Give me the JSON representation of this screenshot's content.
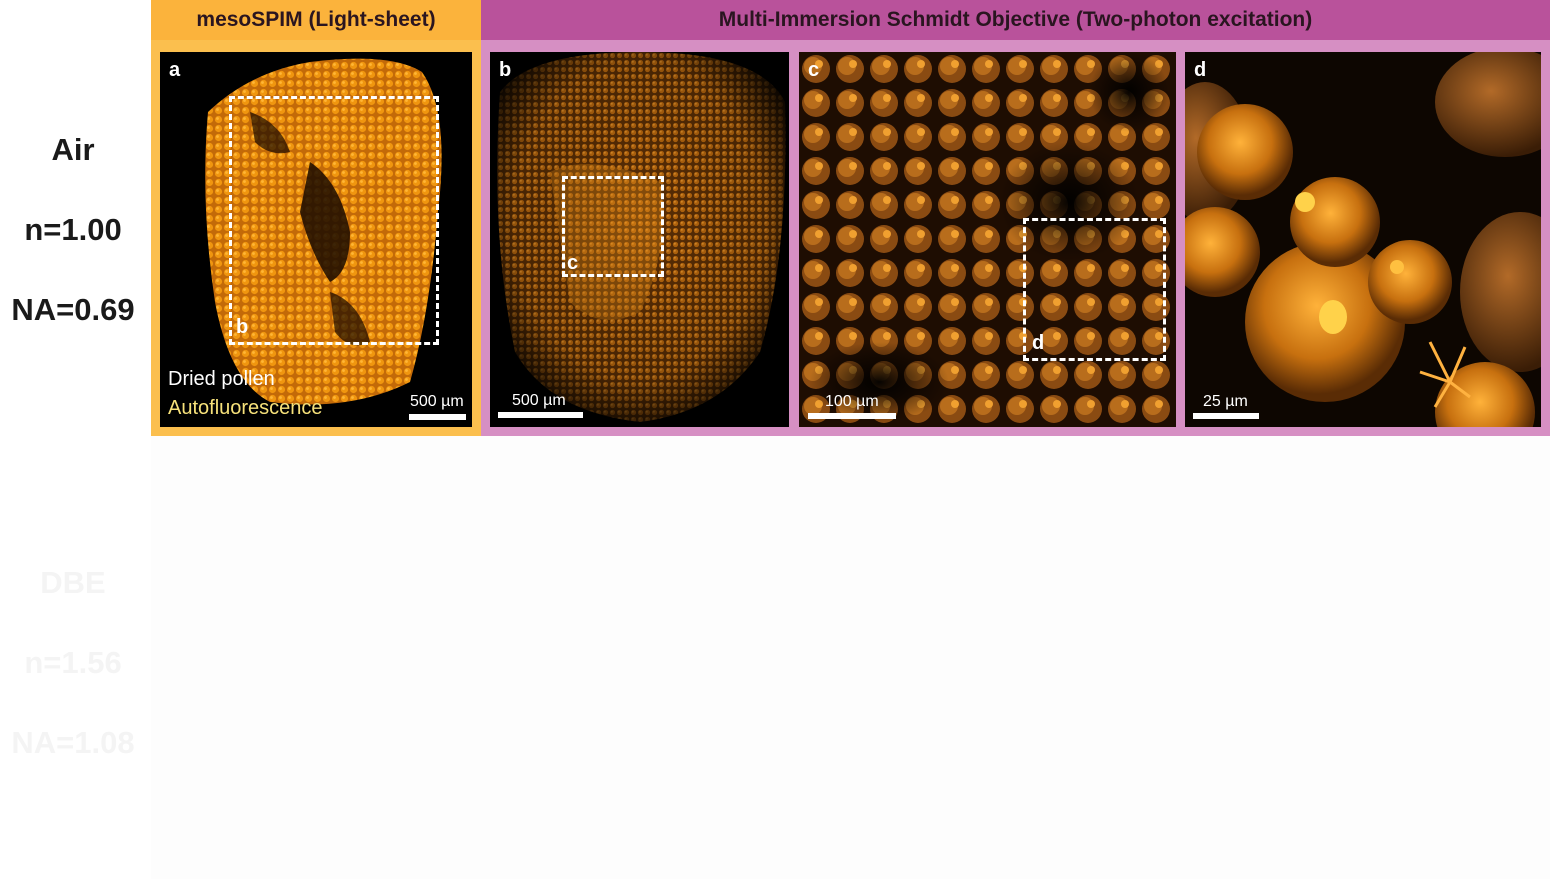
{
  "headers": {
    "left": "mesoSPIM (Light-sheet)",
    "right": "Multi-Immersion Schmidt Objective (Two-photon excitation)"
  },
  "rows": [
    {
      "medium": "Air",
      "n": "n=1.00",
      "na": "NA=0.69"
    },
    {
      "medium": "DBE",
      "n": "n=1.56",
      "na": "NA=1.08"
    }
  ],
  "panels": {
    "a": {
      "label": "a",
      "scale": "500 µm",
      "sample": "Dried pollen",
      "channel": "Autofluorescence",
      "roi": "b"
    },
    "b": {
      "label": "b",
      "scale": "500 µm",
      "roi": "c"
    },
    "c": {
      "label": "c",
      "scale": "100 µm",
      "roi": "d"
    },
    "d": {
      "label": "d",
      "scale": "25 µm"
    }
  },
  "colors": {
    "mesospim": "#fbbf4e",
    "schmidt": "#b9529b",
    "schmidt_frame": "#d68fc3",
    "autofluorescence_text": "#f6e17a",
    "pollen": "#e8890f"
  }
}
